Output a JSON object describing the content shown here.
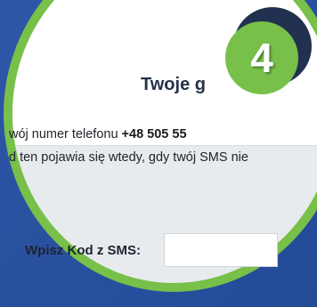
{
  "heading": "Twoje g",
  "sms_info": {
    "phone_prefix": "wój numer telefonu ",
    "phone_number": "+48 505 55",
    "explanation": "d ten pojawia się wtedy, gdy twój SMS nie"
  },
  "sms_code": {
    "label": "Wpisz Kod z SMS:",
    "value": "",
    "placeholder": ""
  },
  "step_badge": "4",
  "colors": {
    "background": "#2b4d9c",
    "ring": "#78c04a",
    "badge_shadow": "#22314f",
    "panel": "#ffffff",
    "form_area": "#e8ebee"
  }
}
